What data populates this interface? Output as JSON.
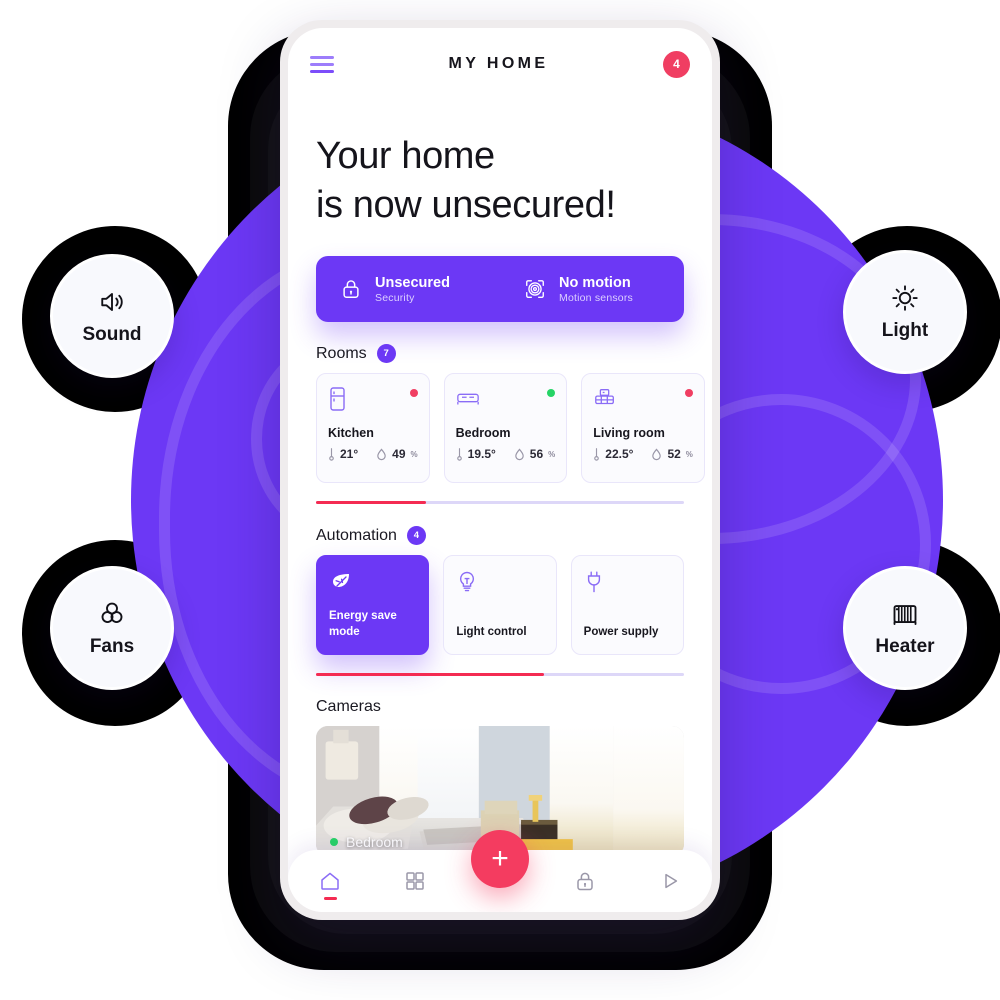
{
  "app": {
    "title": "MY HOME",
    "menu_icon": "hamburger-icon",
    "notifications_count": "4"
  },
  "headline": {
    "line1": "Your home",
    "line2": "is now unsecured!"
  },
  "status_banner": {
    "items": [
      {
        "icon": "lock-icon",
        "title": "Unsecured",
        "subtitle": "Security"
      },
      {
        "icon": "motion-sensor-icon",
        "title": "No motion",
        "subtitle": "Motion sensors"
      }
    ],
    "background_color": "#6c38f5"
  },
  "rooms": {
    "section_title": "Rooms",
    "count": "7",
    "scroll_progress": 30,
    "cards": [
      {
        "icon": "refrigerator-icon",
        "name": "Kitchen",
        "status_color": "#f03e62",
        "temperature": "21°",
        "humidity": "49",
        "humidity_unit": "%"
      },
      {
        "icon": "bed-icon",
        "name": "Bedroom",
        "status_color": "#26d466",
        "temperature": "19.5°",
        "humidity": "56",
        "humidity_unit": "%"
      },
      {
        "icon": "sofa-icon",
        "name": "Living room",
        "status_color": "#f03e62",
        "temperature": "22.5°",
        "humidity": "52",
        "humidity_unit": "%"
      }
    ]
  },
  "automation": {
    "section_title": "Automation",
    "count": "4",
    "scroll_progress": 62,
    "cards": [
      {
        "icon": "leaf-icon",
        "label": "Energy save mode",
        "active": true
      },
      {
        "icon": "bulb-icon",
        "label": "Light control",
        "active": false
      },
      {
        "icon": "plug-icon",
        "label": "Power supply",
        "active": false
      }
    ]
  },
  "cameras": {
    "section_title": "Cameras",
    "feed_label": "Bedroom",
    "feed_status_color": "#26d466"
  },
  "bottom_nav": {
    "items": [
      {
        "icon": "home-icon",
        "active": true
      },
      {
        "icon": "grid-icon",
        "active": false
      },
      {
        "icon": "lock-icon",
        "active": false
      },
      {
        "icon": "play-icon",
        "active": false
      }
    ],
    "fab_icon": "plus-icon",
    "fab_color": "#f43c60"
  },
  "side_bubbles": [
    {
      "icon": "speaker-icon",
      "label": "Sound"
    },
    {
      "icon": "sun-icon",
      "label": "Light"
    },
    {
      "icon": "fan-icon",
      "label": "Fans"
    },
    {
      "icon": "radiator-icon",
      "label": "Heater"
    }
  ],
  "theme": {
    "purple": "#6c38f5",
    "pink": "#f43c60",
    "green": "#26d466",
    "red": "#f03e62"
  }
}
